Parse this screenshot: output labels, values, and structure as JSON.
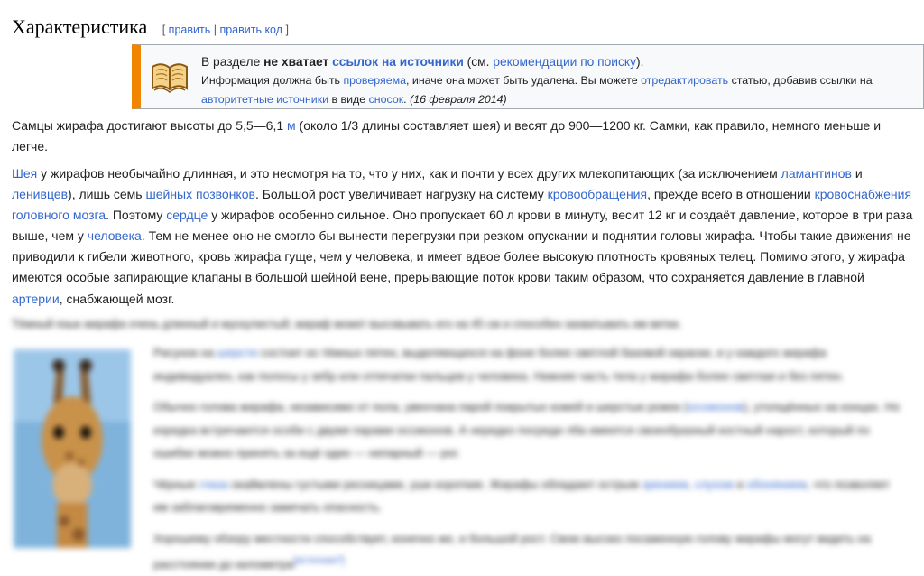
{
  "heading": {
    "title": "Характеристика",
    "edit_open": "[",
    "edit_label": "править",
    "edit_sep": "|",
    "edit_code_label": "править код",
    "edit_close": "]"
  },
  "notice": {
    "l1_a": "В разделе ",
    "l1_b": "не хватает",
    "l1_c": "ссылок на источники",
    "l1_d": " (см. ",
    "l1_e": "рекомендации по поиску",
    "l1_f": ").",
    "l2_a": "Информация должна быть ",
    "l2_b": "проверяема",
    "l2_c": ", иначе она может быть удалена. Вы можете ",
    "l2_d": "отредактировать",
    "l2_e": " статью, добавив ссылки на",
    "l3_a": "авторитетные источники",
    "l3_b": " в виде ",
    "l3_c": "сносок",
    "l3_d": ". ",
    "l3_e": "(16 февраля 2014)"
  },
  "para1": {
    "a": "Самцы жирафа достигают высоты до 5,5—6,1 ",
    "b": "м",
    "c": " (около 1/3 длины составляет шея) и весят до 900—1200 кг. Самки, как правило, немного меньше и легче."
  },
  "para2": {
    "a": "Шея",
    "b": " у жирафов необычайно длинная, и это несмотря на то, что у них, как и почти у всех других млекопитающих (за исключением ",
    "c": "ламантинов",
    "d": " и ",
    "e": "ленивцев",
    "f": "), лишь семь ",
    "g": "шейных позвонков",
    "h": ". Большой рост увеличивает нагрузку на систему ",
    "i": "кровообращения",
    "j": ", прежде всего в отношении ",
    "k": "кровоснабжения головного мозга",
    "l": ". Поэтому ",
    "m": "сердце",
    "n": " у жирафов особенно сильное. Оно пропускает 60 л крови в минуту, весит 12 кг и создаёт давление, которое в три раза выше, чем у ",
    "o": "человека",
    "p": ". Тем не менее оно не смогло бы вынести перегрузки при резком опускании и поднятии головы жирафа. Чтобы такие движения не приводили к гибели животного, кровь жирафа гуще, чем у человека, и имеет вдвое более высокую плотность кровяных телец. Помимо этого, у жирафа имеются особые запирающие клапаны в большой шейной вене, прерывающие поток крови таким образом, что сохраняется давление в главной ",
    "q": "артерии",
    "r": ", снабжающей мозг."
  },
  "blurred": {
    "p3": "Тёмный язык жирафа очень длинный и мускулистый; жираф может высовывать его на 45 см и способен захватывать им ветки.",
    "p4_a": "Рисунок на ",
    "p4_b": "шерсти",
    "p4_c": " состоит из тёмных пятен, выделяющихся на фоне более светлой базовой окраски, и у каждого жирафа индивидуален, как полосы у зебр или отпечатки пальцев у человека. Нижняя часть тела у жирафа более светлая и без пятен.",
    "p5_a": "Обычно голова жирафа, независимо от пола, увенчана парой покрытых кожей и шерстью рожек (",
    "p5_b": "оссиконов",
    "p5_c": "), утолщённых на концах. Но изредка встречаются особи с двумя парами оссиконов. А нередко посреди лба имеется своеобразный костный нарост, который по ошибке можно принять за ещё один — непарный — рог.",
    "p6_a": "Чёрные ",
    "p6_b": "глаза",
    "p6_c": " окаймлены густыми ресницами, уши короткие. Жирафы обладают острым ",
    "p6_d": "зрением",
    "p6_e": ", ",
    "p6_f": "слухом",
    "p6_g": " и ",
    "p6_h": "обонянием",
    "p6_i": ", что позволяет им заблаговременно замечать опасность.",
    "p7_a": "Хорошему обзору местности способствует, конечно же, и большой рост. Свою высоко посаженную голову жирафы могут видеть на расстоянии до километра",
    "p7_b": "[источник?]"
  },
  "colors": {
    "link": "#3366cc",
    "ambox_stripe": "#f28500",
    "ambox_bg": "#f8f9fa",
    "border": "#a2a9b1"
  },
  "icons": {
    "notice": "open-book-icon",
    "image": "giraffe-photo"
  }
}
